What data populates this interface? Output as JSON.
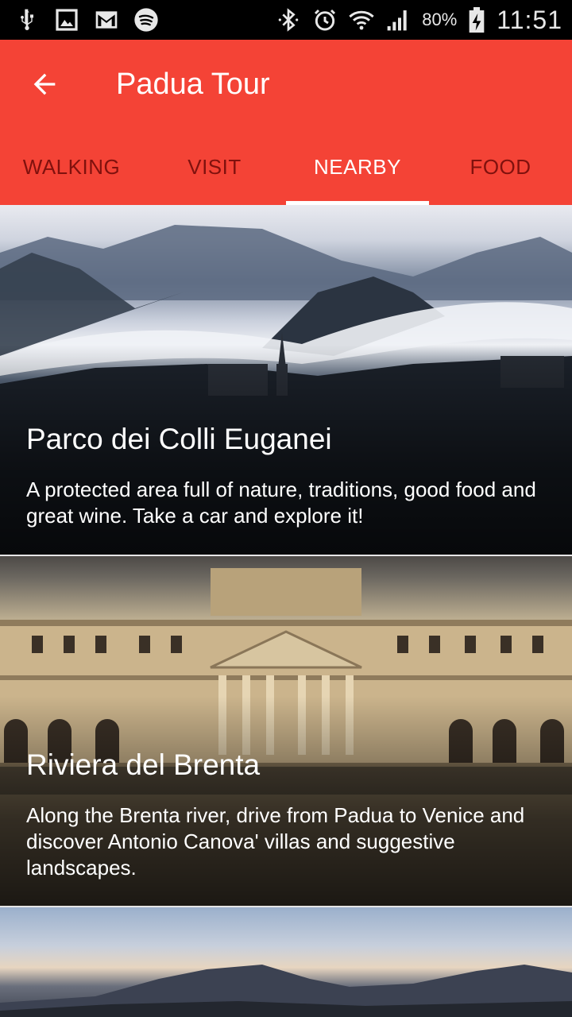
{
  "status_bar": {
    "battery": "80%",
    "time": "11:51",
    "icons_left": [
      "usb-icon",
      "image-icon",
      "gmail-icon",
      "spotify-icon"
    ],
    "icons_right": [
      "bluetooth-icon",
      "alarm-icon",
      "wifi-icon",
      "signal-icon",
      "battery-charging-icon"
    ]
  },
  "app_bar": {
    "title": "Padua Tour",
    "color": "#f44336"
  },
  "tabs": [
    {
      "label": "WALKING",
      "active": false
    },
    {
      "label": "VISIT",
      "active": false
    },
    {
      "label": "NEARBY",
      "active": true
    },
    {
      "label": "FOOD",
      "active": false
    }
  ],
  "cards": [
    {
      "title": "Parco dei Colli Euganei",
      "description": "A protected area full of nature, traditions, good food and great wine. Take a car and explore it!"
    },
    {
      "title": "Riviera del Brenta",
      "description": "Along the Brenta river, drive from Padua to Venice and discover Antonio Canova' villas and suggestive landscapes."
    }
  ]
}
